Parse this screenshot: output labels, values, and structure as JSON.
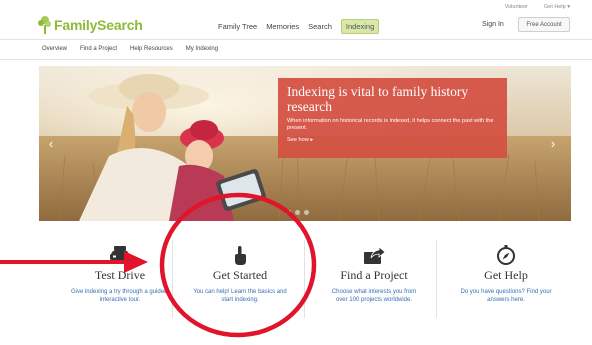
{
  "header": {
    "logo_text": "FamilySearch",
    "top_links": [
      "Volunteer",
      "Get Help ▾"
    ],
    "nav": [
      "Family Tree",
      "Memories",
      "Search",
      "Indexing"
    ],
    "nav_active": "Indexing",
    "sign_in": "Sign In",
    "free_account": "Free Account"
  },
  "subnav": [
    "Overview",
    "Find a Project",
    "Help Resources",
    "My Indexing"
  ],
  "hero": {
    "title": "Indexing is vital to family history research",
    "body": "When information on historical records is indexed, it helps connect the past with the present.",
    "link": "See how ▸",
    "prev_arrow": "‹",
    "next_arrow": "›",
    "promo_color": "#d45042"
  },
  "features": [
    {
      "icon": "car-icon",
      "title": "Test Drive",
      "desc": "Give indexing a try through a guided, interactive tour."
    },
    {
      "icon": "tap-hand-icon",
      "title": "Get Started",
      "desc": "You can help! Learn the basics and start indexing."
    },
    {
      "icon": "share-project-icon",
      "title": "Find a Project",
      "desc": "Choose what interests you from over 100 projects worldwide."
    },
    {
      "icon": "compass-icon",
      "title": "Get Help",
      "desc": "Do you have questions? Find your answers here."
    }
  ],
  "colors": {
    "brand_green": "#8dba3b",
    "link_blue": "#3a6fb4",
    "annotation_red": "#e0152b"
  }
}
